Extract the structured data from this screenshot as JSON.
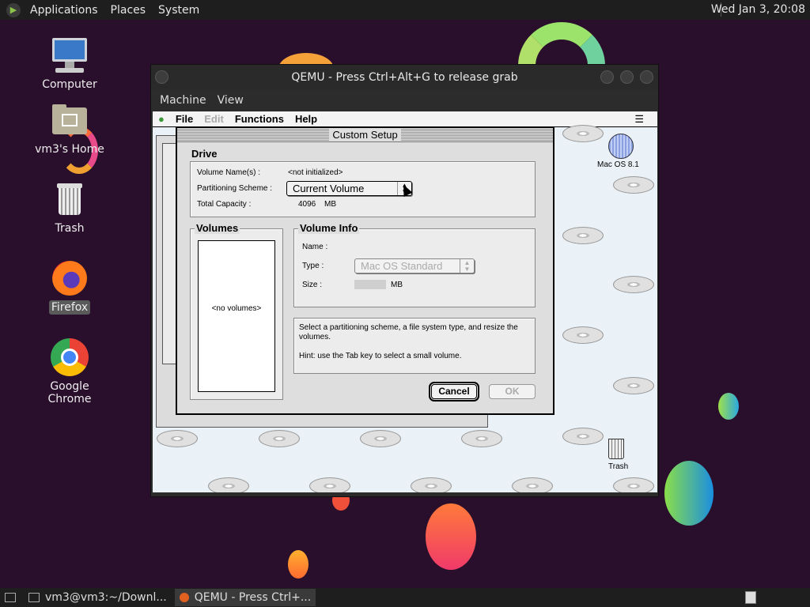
{
  "top_panel": {
    "menus": [
      "Applications",
      "Places",
      "System"
    ],
    "clock": "Wed Jan  3, 20:08"
  },
  "desktop_icons": [
    {
      "label": "Computer",
      "icon": "computer-icon"
    },
    {
      "label": "vm3's Home",
      "icon": "home-folder-icon"
    },
    {
      "label": "Trash",
      "icon": "trash-icon"
    },
    {
      "label": "Firefox",
      "icon": "firefox-icon"
    },
    {
      "label": "Google Chrome",
      "icon": "chrome-icon"
    }
  ],
  "qemu": {
    "title": "QEMU - Press Ctrl+Alt+G to release grab",
    "menu": [
      "Machine",
      "View"
    ]
  },
  "mac": {
    "menu": [
      "File",
      "Edit",
      "Functions",
      "Help"
    ],
    "disk_label": "Mac OS 8.1",
    "trash_label": "Trash"
  },
  "dialog": {
    "title": "Custom Setup",
    "drive_title": "Drive",
    "volume_names_label": "Volume Name(s) :",
    "volume_names_value": "<not initialized>",
    "partitioning_label": "Partitioning Scheme :",
    "partitioning_value": "Current Volume",
    "capacity_label": "Total Capacity :",
    "capacity_value": "4096",
    "capacity_unit": "MB",
    "volumes_title": "Volumes",
    "no_volumes": "<no volumes>",
    "volume_info_title": "Volume Info",
    "name_label": "Name :",
    "type_label": "Type :",
    "type_value": "Mac OS Standard",
    "size_label": "Size :",
    "size_unit": "MB",
    "help_text": "Select a partitioning scheme, a file system type, and resize the volumes.",
    "hint_text": "Hint: use the Tab key to select a small volume.",
    "cancel_label": "Cancel",
    "ok_label": "OK"
  },
  "taskbar": {
    "tasks": [
      "vm3@vm3:~/Downl...",
      "QEMU - Press Ctrl+..."
    ]
  }
}
